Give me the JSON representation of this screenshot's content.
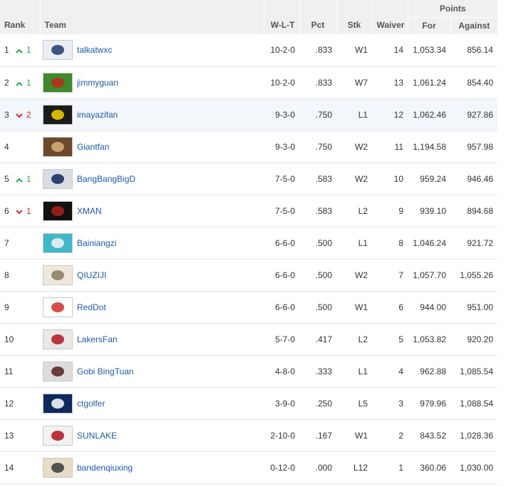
{
  "headers": {
    "rank": "Rank",
    "team": "Team",
    "wlt": "W-L-T",
    "pct": "Pct",
    "stk": "Stk",
    "waiver": "Waiver",
    "points": "Points",
    "for": "For",
    "against": "Against"
  },
  "rows": [
    {
      "rank": "1",
      "dir": "up",
      "move": "1",
      "team": "talkatwxc",
      "wlt": "10-2-0",
      "pct": ".833",
      "stk": "W1",
      "waiver": "14",
      "pf": "1,053.34",
      "pa": "856.14",
      "logo": {
        "name": "patriots-logo",
        "bg": "#e9eef5",
        "fg": "#1b3a6b"
      }
    },
    {
      "rank": "2",
      "dir": "up",
      "move": "1",
      "team": "jimmyguan",
      "wlt": "10-2-0",
      "pct": ".833",
      "stk": "W7",
      "waiver": "13",
      "pf": "1,061.24",
      "pa": "854.40",
      "logo": {
        "name": "lobster-logo",
        "bg": "#3e8a2c",
        "fg": "#c0281f"
      }
    },
    {
      "rank": "3",
      "dir": "down",
      "move": "2",
      "team": "imayazifan",
      "wlt": "9-3-0",
      "pct": ".750",
      "stk": "L1",
      "waiver": "12",
      "pf": "1,062.46",
      "pa": "927.86",
      "logo": {
        "name": "oregon-o-logo",
        "bg": "#1b1b1b",
        "fg": "#f4d000"
      }
    },
    {
      "rank": "4",
      "dir": "",
      "move": "",
      "team": "Giantfan",
      "wlt": "9-3-0",
      "pct": ".750",
      "stk": "W2",
      "waiver": "11",
      "pf": "1,194.58",
      "pa": "957.98",
      "logo": {
        "name": "warrior-portrait-logo",
        "bg": "#6b4a2b",
        "fg": "#d8b07a"
      }
    },
    {
      "rank": "5",
      "dir": "up",
      "move": "1",
      "team": "BangBangBigD",
      "wlt": "7-5-0",
      "pct": ".583",
      "stk": "W2",
      "waiver": "10",
      "pf": "959.24",
      "pa": "946.46",
      "logo": {
        "name": "cowboys-star-logo",
        "bg": "#d9dde3",
        "fg": "#0d2a5a"
      }
    },
    {
      "rank": "6",
      "dir": "down",
      "move": "1",
      "team": "XMAN",
      "wlt": "7-5-0",
      "pct": ".583",
      "stk": "L2",
      "waiver": "9",
      "pf": "939.10",
      "pa": "894.68",
      "logo": {
        "name": "xman-logo",
        "bg": "#111111",
        "fg": "#b01e1e"
      }
    },
    {
      "rank": "7",
      "dir": "",
      "move": "",
      "team": "Bainiangzi",
      "wlt": "6-6-0",
      "pct": ".500",
      "stk": "L1",
      "waiver": "8",
      "pf": "1,046.24",
      "pa": "921.72",
      "logo": {
        "name": "white-lady-logo",
        "bg": "#40b8c8",
        "fg": "#f2f2f2"
      }
    },
    {
      "rank": "8",
      "dir": "",
      "move": "",
      "team": "QIUZIJI",
      "wlt": "6-6-0",
      "pct": ".500",
      "stk": "W2",
      "waiver": "7",
      "pf": "1,057.70",
      "pa": "1,055.26",
      "logo": {
        "name": "old-man-logo",
        "bg": "#efe9dc",
        "fg": "#8a7a60"
      }
    },
    {
      "rank": "9",
      "dir": "",
      "move": "",
      "team": "RedDot",
      "wlt": "6-6-0",
      "pct": ".500",
      "stk": "W1",
      "waiver": "6",
      "pf": "944.00",
      "pa": "951.00",
      "logo": {
        "name": "reddot-logo",
        "bg": "#ffffff",
        "fg": "#d42a2a"
      }
    },
    {
      "rank": "10",
      "dir": "",
      "move": "",
      "team": "LakersFan",
      "wlt": "5-7-0",
      "pct": ".417",
      "stk": "L2",
      "waiver": "5",
      "pf": "1,053.82",
      "pa": "920.20",
      "logo": {
        "name": "ohio-state-logo",
        "bg": "#e8e8e8",
        "fg": "#b0161e"
      }
    },
    {
      "rank": "11",
      "dir": "",
      "move": "",
      "team": "Gobi BingTuan",
      "wlt": "4-8-0",
      "pct": ".333",
      "stk": "L1",
      "waiver": "4",
      "pf": "962.88",
      "pa": "1,085.54",
      "logo": {
        "name": "helmet-logo",
        "bg": "#dcdcdc",
        "fg": "#5a1e22"
      }
    },
    {
      "rank": "12",
      "dir": "",
      "move": "",
      "team": "ctgolfer",
      "wlt": "3-9-0",
      "pct": ".250",
      "stk": "L5",
      "waiver": "3",
      "pf": "979.96",
      "pa": "1,088.54",
      "logo": {
        "name": "uconn-husky-logo",
        "bg": "#0e2a5c",
        "fg": "#ffffff"
      }
    },
    {
      "rank": "13",
      "dir": "",
      "move": "",
      "team": "SUNLAKE",
      "wlt": "2-10-0",
      "pct": ".167",
      "stk": "W1",
      "waiver": "2",
      "pf": "843.52",
      "pa": "1,028.36",
      "logo": {
        "name": "49ers-logo",
        "bg": "#f2f2f2",
        "fg": "#b3121d"
      }
    },
    {
      "rank": "14",
      "dir": "",
      "move": "",
      "team": "bandenqiuxing",
      "wlt": "0-12-0",
      "pct": ".000",
      "stk": "L12",
      "waiver": "1",
      "pf": "360.06",
      "pa": "1,030.00",
      "logo": {
        "name": "badge-logo",
        "bg": "#e6dcc8",
        "fg": "#3a3a3a"
      }
    }
  ],
  "highlight_row": "3",
  "colors": {
    "up": "#29a84a",
    "down": "#c9302c",
    "link": "#1f5aa8",
    "header_bg": "#f0f0f0"
  }
}
